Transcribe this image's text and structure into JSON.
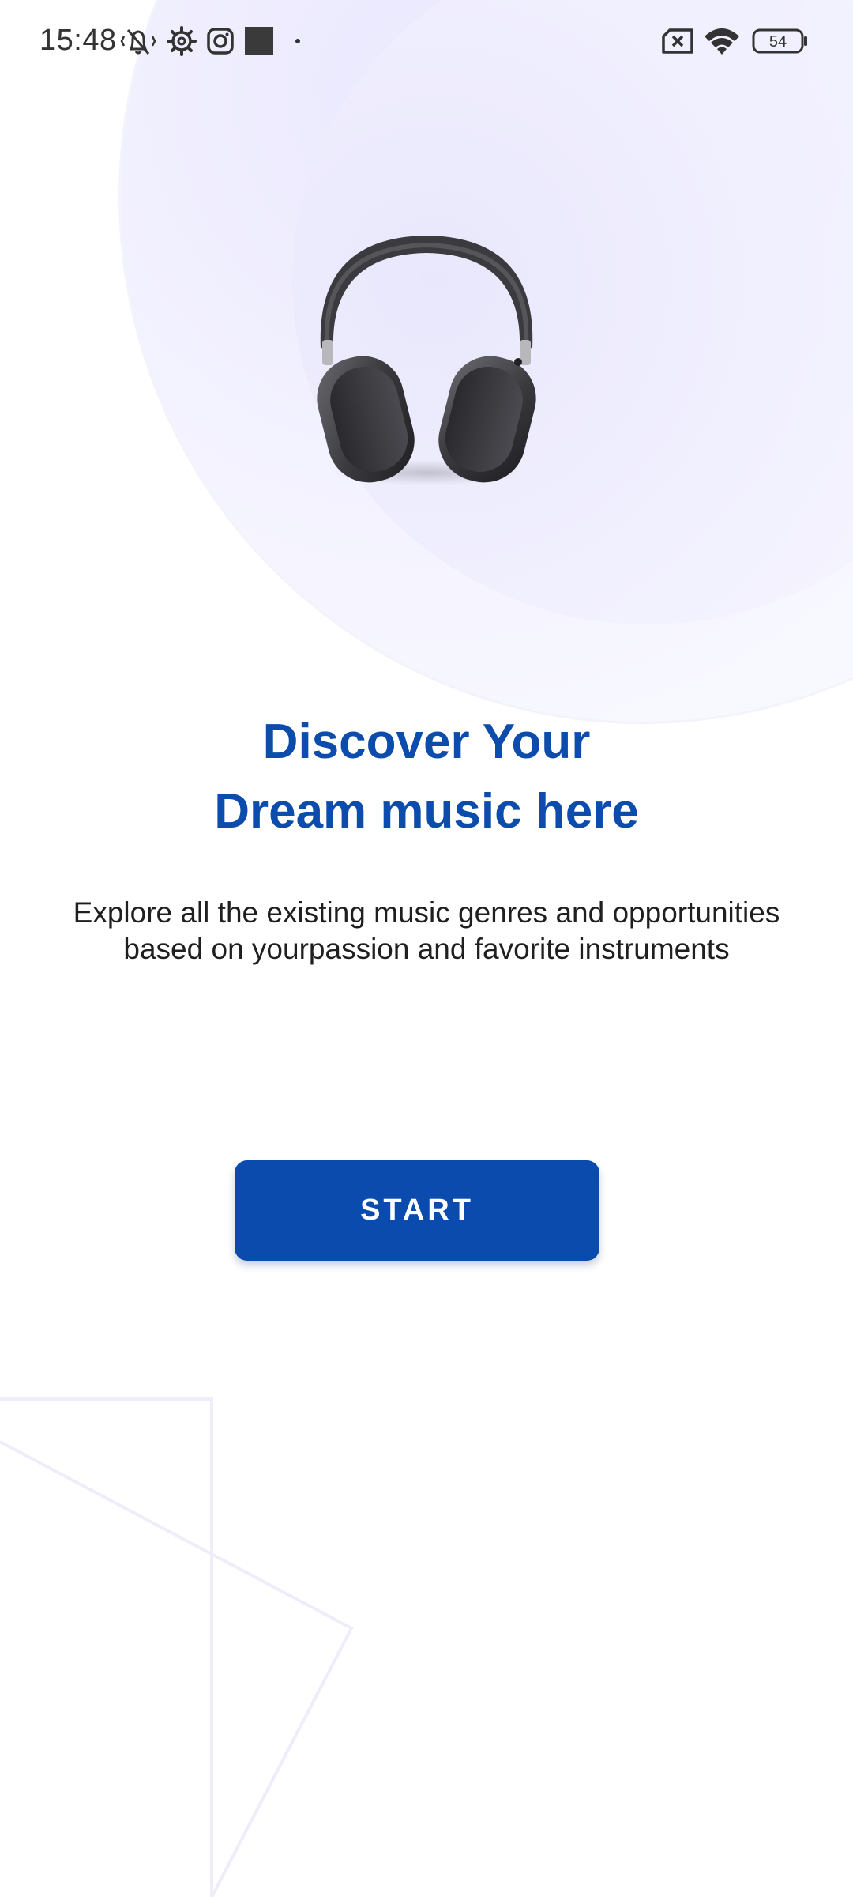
{
  "status_bar": {
    "time": "15:48",
    "battery": "54",
    "icons": [
      "vibrate-off-icon",
      "settings-icon",
      "instagram-icon",
      "app-square-icon",
      "dot-icon",
      "no-sim-icon",
      "wifi-icon",
      "battery-icon"
    ]
  },
  "hero": {
    "image": "headphones-icon",
    "title_line1": "Discover Your",
    "title_line2": "Dream music here",
    "description_line1": "Explore all the existing music genres and opportunities",
    "description_line2": "based on yourpassion and favorite instruments"
  },
  "actions": {
    "start_label": "START"
  },
  "colors": {
    "primary": "#0a4bad",
    "title": "#0b4cac",
    "background": "#ffffff",
    "accent_blob": "#eeedfd"
  }
}
